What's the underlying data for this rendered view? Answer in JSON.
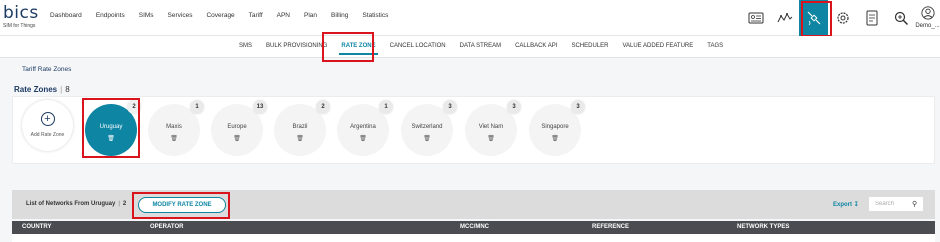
{
  "brand": {
    "name": "bics",
    "tagline": "SIM for Things"
  },
  "nav": [
    "Dashboard",
    "Endpoints",
    "SIMs",
    "Services",
    "Coverage",
    "Tariff",
    "APN",
    "Plan",
    "Billing",
    "Statistics"
  ],
  "user": {
    "name": "Demo_..."
  },
  "header_icons": [
    "id-card-icon",
    "network-icon",
    "satellite-icon",
    "settings-icon",
    "document-icon",
    "zoom-icon"
  ],
  "subnav": {
    "tabs": [
      "SMS",
      "BULK PROVISIONING",
      "RATE ZONE",
      "CANCEL LOCATION",
      "DATA STREAM",
      "CALLBACK API",
      "SCHEDULER",
      "VALUE ADDED FEATURE",
      "TAGS"
    ],
    "active": "RATE ZONE"
  },
  "breadcrumb": {
    "parent": "Tariff",
    "current": "Rate Zones"
  },
  "rate_zones": {
    "title": "Rate Zones",
    "count": "8",
    "add_label": "Add Rate Zone",
    "zones": [
      {
        "name": "Uruguay",
        "count": "2",
        "selected": true
      },
      {
        "name": "Maxis",
        "count": "1"
      },
      {
        "name": "Europe",
        "count": "13"
      },
      {
        "name": "Brazil",
        "count": "2"
      },
      {
        "name": "Argentina",
        "count": "1"
      },
      {
        "name": "Switzerland",
        "count": "3"
      },
      {
        "name": "Viet Nam",
        "count": "3"
      },
      {
        "name": "Singapore",
        "count": "3"
      }
    ]
  },
  "networks": {
    "title": "List of Networks From Uruguay",
    "count": "2",
    "modify_label": "MODIFY RATE ZONE",
    "export_label": "Export",
    "search_placeholder": "Search",
    "columns": [
      "COUNTRY",
      "OPERATOR",
      "MCC/MNC",
      "REFERENCE",
      "NETWORK TYPES"
    ]
  },
  "colors": {
    "accent": "#0d85a3",
    "highlight": "#d9141c",
    "brand": "#1d3b63",
    "table_header": "#4a4c51"
  }
}
